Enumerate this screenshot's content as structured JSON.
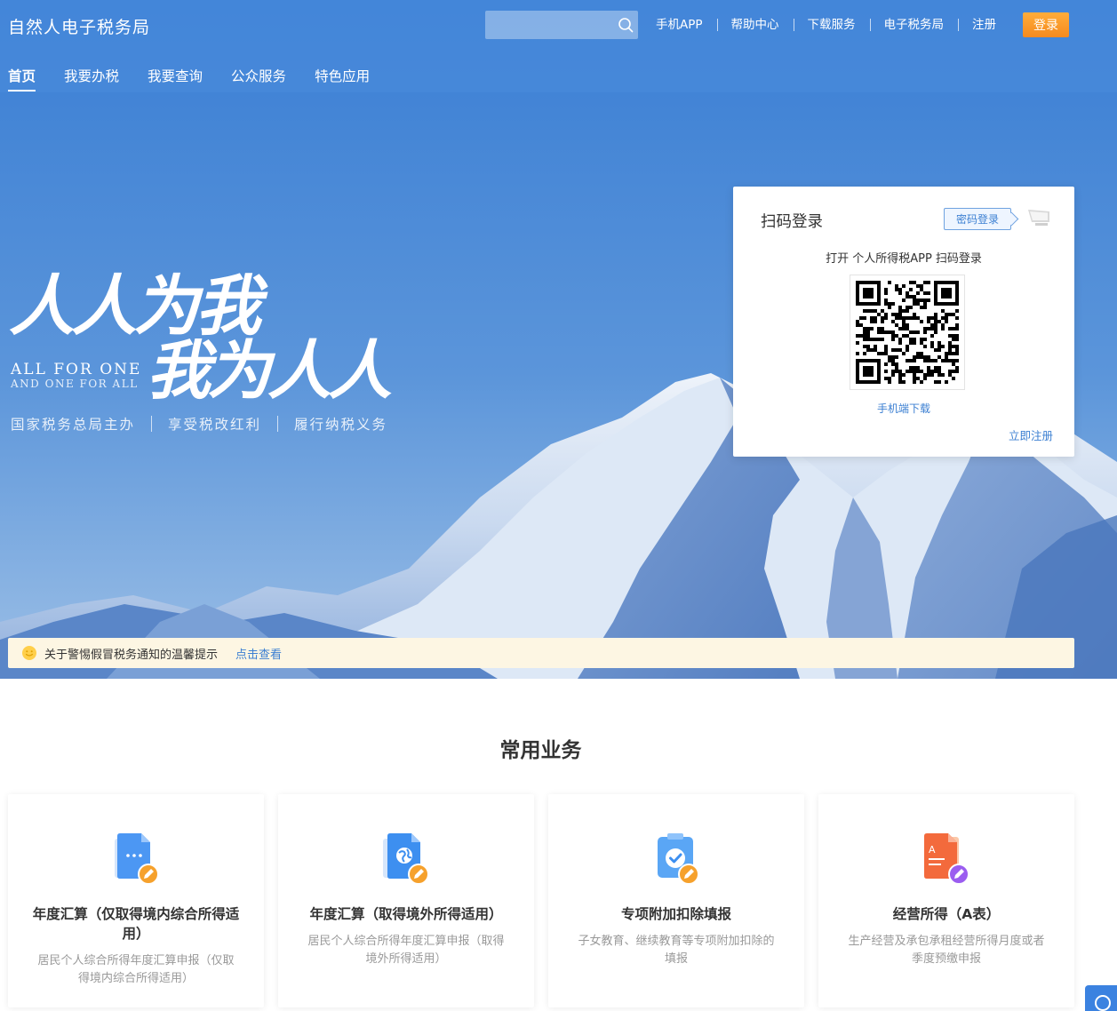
{
  "header": {
    "brand": "自然人电子税务局",
    "search": {
      "value": "",
      "placeholder": ""
    },
    "top_links": [
      "手机APP",
      "帮助中心",
      "下载服务",
      "电子税务局",
      "注册"
    ],
    "login_label": "登录",
    "nav": [
      {
        "label": "首页",
        "active": true
      },
      {
        "label": "我要办税",
        "active": false
      },
      {
        "label": "我要查询",
        "active": false
      },
      {
        "label": "公众服务",
        "active": false
      },
      {
        "label": "特色应用",
        "active": false
      }
    ]
  },
  "hero": {
    "calligraphy_line1": "人人为我",
    "calligraphy_line2": "我为人人",
    "english_line1": "ALL FOR ONE",
    "english_line2": "AND ONE FOR ALL",
    "taglines": [
      "国家税务总局主办",
      "享受税改红利",
      "履行纳税义务"
    ]
  },
  "login_card": {
    "title": "扫码登录",
    "password_login": "密码登录",
    "scan_tip": "打开 个人所得税APP 扫码登录",
    "mobile_download": "手机端下载",
    "register_now": "立即注册"
  },
  "notice": {
    "text": "关于警惕假冒税务通知的温馨提示",
    "link": "点击查看"
  },
  "common_business": {
    "title": "常用业务",
    "cards": [
      {
        "title": "年度汇算（仅取得境内综合所得适用）",
        "desc": "居民个人综合所得年度汇算申报（仅取得境内综合所得适用）",
        "icon": "document-edit-icon"
      },
      {
        "title": "年度汇算（取得境外所得适用）",
        "desc": "居民个人综合所得年度汇算申报（取得境外所得适用）",
        "icon": "globe-document-icon"
      },
      {
        "title": "专项附加扣除填报",
        "desc": "子女教育、继续教育等专项附加扣除的填报",
        "icon": "clipboard-check-icon"
      },
      {
        "title": "经营所得（A表）",
        "desc": "生产经营及承包承租经营所得月度或者季度预缴申报",
        "icon": "form-a-icon"
      }
    ]
  },
  "colors": {
    "accent": "#3b7fd2",
    "login_button": "#f58a1f",
    "notice_bg": "#fdf6e3"
  }
}
